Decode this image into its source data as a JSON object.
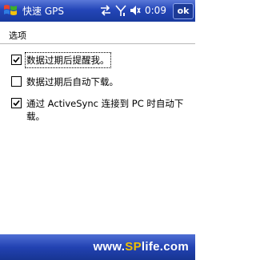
{
  "titlebar": {
    "title": "快速 GPS",
    "time": "0:09",
    "ok_label": "ok",
    "start_icon": "windows-flag-icon",
    "status_icons": [
      "sync-arrows-icon",
      "signal-icon",
      "volume-icon"
    ]
  },
  "tab": {
    "label": "选项"
  },
  "options": [
    {
      "label": "数据过期后提醒我。",
      "checked": true
    },
    {
      "label": "数据过期后自动下载。",
      "checked": false
    },
    {
      "label": "通过 ActiveSync 连接到 PC 时自动下载。",
      "checked": true
    }
  ],
  "watermark": {
    "prefix": "www.",
    "brand": "SP",
    "suffix": "life.com"
  },
  "colors": {
    "titlebar": "#2446b8",
    "bottombar": "#2242b2",
    "brand_accent": "#f0c000"
  }
}
